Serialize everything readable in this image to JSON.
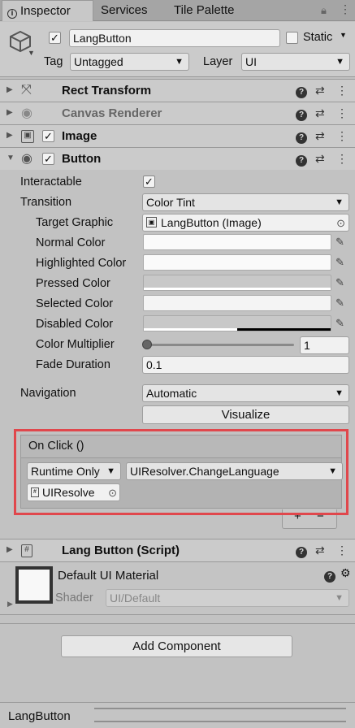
{
  "tabs": [
    {
      "label": "Inspector"
    },
    {
      "label": "Services"
    },
    {
      "label": "Tile Palette"
    }
  ],
  "object": {
    "name": "LangButton",
    "active": true,
    "static_label": "Static",
    "tag_label": "Tag",
    "tag_value": "Untagged",
    "layer_label": "Layer",
    "layer_value": "UI"
  },
  "components": {
    "rect_transform": "Rect Transform",
    "canvas_renderer": "Canvas Renderer",
    "image": "Image",
    "button": "Button",
    "lang_button": "Lang Button (Script)"
  },
  "button": {
    "interactable_label": "Interactable",
    "transition_label": "Transition",
    "transition_value": "Color Tint",
    "target_graphic_label": "Target Graphic",
    "target_graphic_value": "LangButton (Image)",
    "normal_color_label": "Normal Color",
    "highlighted_color_label": "Highlighted Color",
    "pressed_color_label": "Pressed Color",
    "selected_color_label": "Selected Color",
    "disabled_color_label": "Disabled Color",
    "color_multiplier_label": "Color Multiplier",
    "color_multiplier_value": "1",
    "color_multiplier_fraction": 0.0,
    "fade_duration_label": "Fade Duration",
    "fade_duration_value": "0.1",
    "navigation_label": "Navigation",
    "navigation_value": "Automatic",
    "visualize_label": "Visualize"
  },
  "on_click": {
    "header": "On Click ()",
    "runtime_value": "Runtime Only",
    "function_value": "UIResolver.ChangeLanguage",
    "object_value": "UIResolve",
    "add_symbol": "+",
    "remove_symbol": "−"
  },
  "material": {
    "name": "Default UI Material",
    "shader_label": "Shader",
    "shader_value": "UI/Default"
  },
  "add_component_label": "Add Component",
  "footer": {
    "object_name": "LangButton"
  },
  "colors": {
    "highlight_box": "#e0474c",
    "panel_bg": "#c2c2c2",
    "header_bg": "#cbcbcb"
  }
}
